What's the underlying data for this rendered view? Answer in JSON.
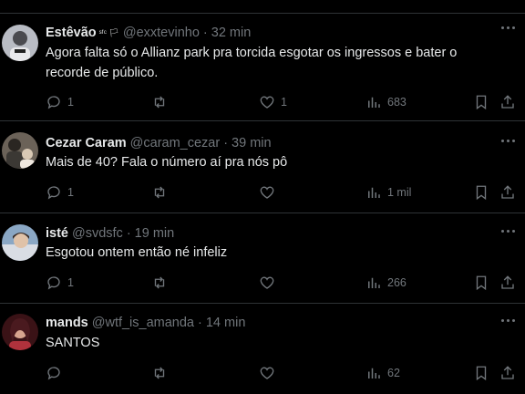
{
  "tweets": [
    {
      "name": "Estêvão",
      "name_badges": "ˢᶠᶜ 🏳",
      "handle": "@exxtevinho",
      "time": "· 32 min",
      "text_lines": [
        "Agora falta só o Allianz park pra torcida esgotar os ingressos e bater o",
        "recorde de público."
      ],
      "replies": "1",
      "retweets": "",
      "likes": "1",
      "views": "683"
    },
    {
      "name": "Cezar Caram",
      "handle": "@caram_cezar",
      "time": "· 39 min",
      "text_lines": [
        "Mais de 40? Fala o número aí pra nós pô"
      ],
      "replies": "1",
      "retweets": "",
      "likes": "",
      "views": "1 mil"
    },
    {
      "name": "isté",
      "handle": "@svdsfc",
      "time": "· 19 min",
      "text_lines": [
        "Esgotou ontem então né infeliz"
      ],
      "replies": "1",
      "retweets": "",
      "likes": "",
      "views": "266"
    },
    {
      "name": "mands",
      "handle": "@wtf_is_amanda",
      "time": "· 14 min",
      "text_lines": [
        "SANTOS"
      ],
      "replies": "",
      "retweets": "",
      "likes": "",
      "views": "62"
    }
  ],
  "icons": {
    "reply": "reply-icon",
    "retweet": "retweet-icon",
    "like": "heart-icon",
    "views": "views-icon",
    "bookmark": "bookmark-icon",
    "share": "share-icon",
    "more": "more-icon"
  },
  "colors": {
    "background": "#000000",
    "text": "#e7e9ea",
    "muted": "#71767b",
    "divider": "#2f3336"
  }
}
